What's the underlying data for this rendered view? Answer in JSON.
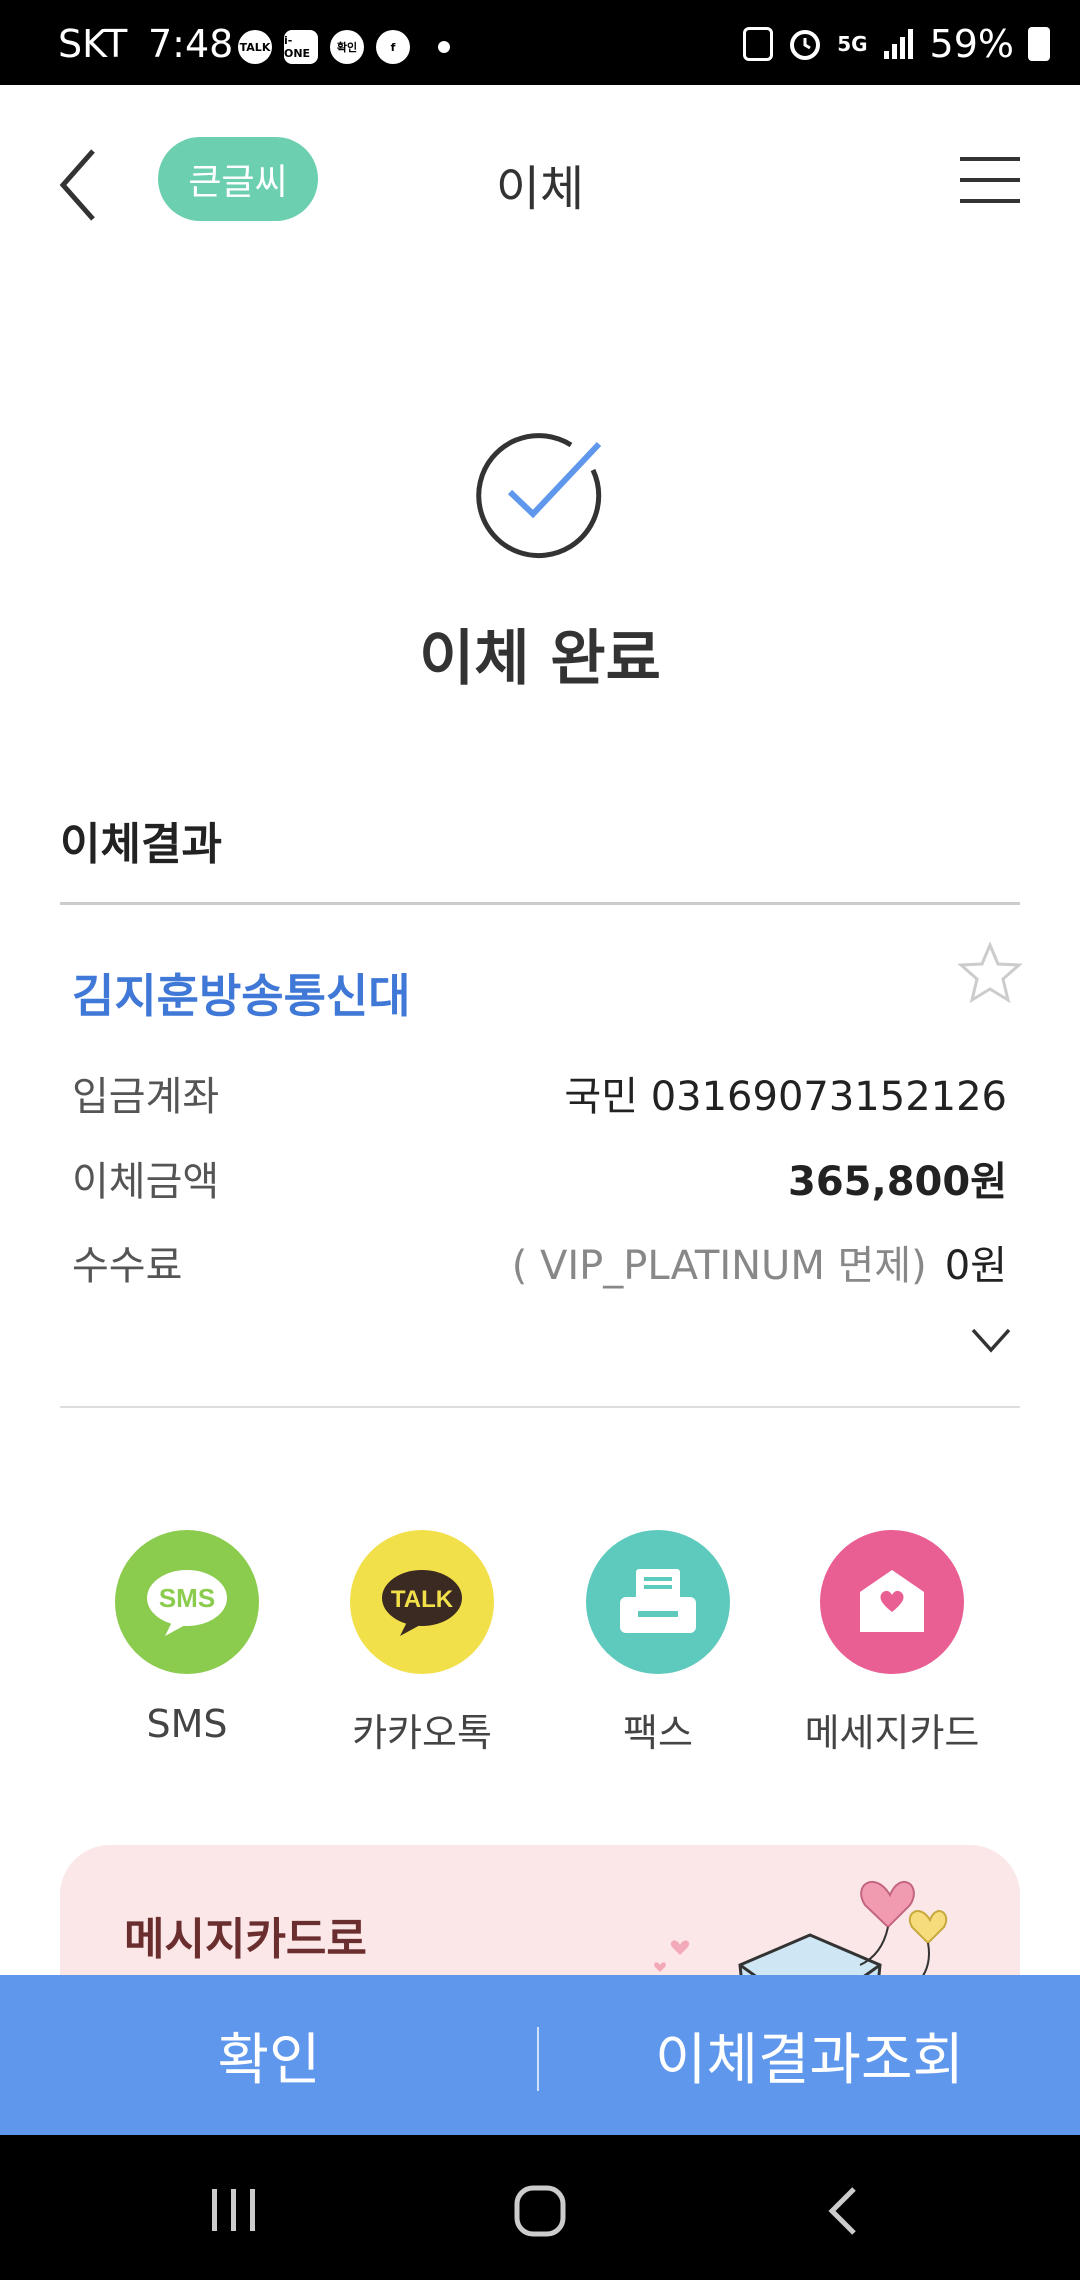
{
  "status_bar": {
    "carrier": "SKT",
    "time": "7:48",
    "app_icons": [
      "TALK",
      "i-ONE",
      "확인",
      "f"
    ],
    "network": "5G",
    "battery": "59%"
  },
  "header": {
    "big_font_label": "큰글씨",
    "title": "이체"
  },
  "completion": {
    "title": "이체 완료"
  },
  "result": {
    "heading": "이체결과",
    "recipient_name": "김지훈방송통신대",
    "rows": [
      {
        "label": "입금계좌",
        "value": "국민 03169073152126",
        "note": ""
      },
      {
        "label": "이체금액",
        "value": "365,800원",
        "note": ""
      },
      {
        "label": "수수료",
        "value": "0원",
        "note": "( VIP_PLATINUM 면제)"
      }
    ]
  },
  "share": [
    {
      "label": "SMS",
      "badge": "SMS",
      "color": "#8bcb4d"
    },
    {
      "label": "카카오톡",
      "badge": "TALK",
      "color": "#f2e04b"
    },
    {
      "label": "팩스",
      "badge": "",
      "color": "#5ec9bd"
    },
    {
      "label": "메세지카드",
      "badge": "",
      "color": "#ea5f93"
    }
  ],
  "banner": {
    "text": "메시지카드로"
  },
  "bottom": {
    "confirm": "확인",
    "lookup": "이체결과조회"
  }
}
